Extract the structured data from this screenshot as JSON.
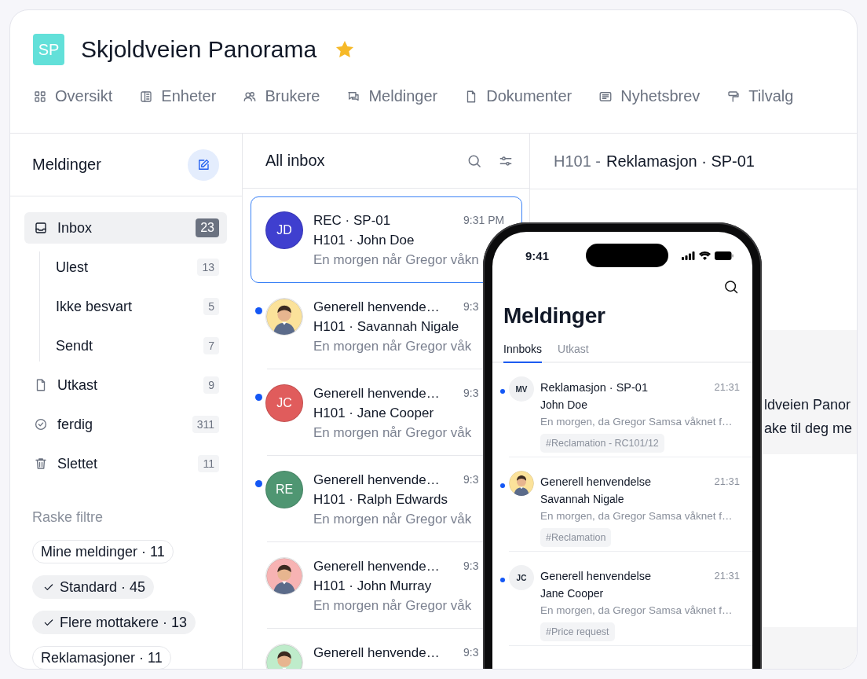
{
  "project": {
    "logo": "SP",
    "title": "Skjoldveien Panorama",
    "starred": true
  },
  "nav_tabs": [
    {
      "label": "Oversikt"
    },
    {
      "label": "Enheter"
    },
    {
      "label": "Brukere"
    },
    {
      "label": "Meldinger"
    },
    {
      "label": "Dokumenter"
    },
    {
      "label": "Nyhetsbrev"
    },
    {
      "label": "Tilvalg"
    }
  ],
  "sidebar": {
    "title": "Meldinger",
    "folders": [
      {
        "label": "Inbox",
        "count": "23",
        "selected": true,
        "children": [
          {
            "label": "Ulest",
            "count": "13",
            "selected": false
          },
          {
            "label": "Ikke besvart",
            "count": "5",
            "selected": false
          },
          {
            "label": "Sendt",
            "count": "7",
            "selected": false
          }
        ]
      },
      {
        "label": "Utkast",
        "count": "9",
        "selected": false
      },
      {
        "label": "ferdig",
        "count": "311",
        "selected": false
      },
      {
        "label": "Slettet",
        "count": "11",
        "selected": false
      }
    ],
    "filters_title": "Raske filtre",
    "filters": [
      {
        "label": "Mine meldinger · 11",
        "checked": false
      },
      {
        "label": "Standard · 45",
        "checked": true
      },
      {
        "label": "Flere mottakere · 13",
        "checked": true
      },
      {
        "label": "Reklamasjoner · 11",
        "checked": false
      }
    ]
  },
  "inbox": {
    "title": "All inbox",
    "messages": [
      {
        "avatar": {
          "kind": "initials",
          "text": "JD",
          "color": "#3f3fcf"
        },
        "title": "REC · SP-01",
        "subtitle": "H101 · John Doe",
        "preview": "En morgen når Gregor våkn",
        "time": "9:31 PM",
        "unread": false,
        "selected": true
      },
      {
        "title": "Generell henvende…",
        "subtitle": "H101 · Savannah Nigale",
        "preview": "En morgen når Gregor våk",
        "time": "9:3",
        "unread": true,
        "selected": false
      },
      {
        "avatar": {
          "kind": "initials",
          "text": "JC",
          "color": "#e05c5c"
        },
        "title": "Generell henvende…",
        "subtitle": "H101 · Jane Cooper",
        "preview": "En morgen når Gregor våk",
        "time": "9:3",
        "unread": true,
        "selected": false
      },
      {
        "avatar": {
          "kind": "initials",
          "text": "RE",
          "color": "#4f9672"
        },
        "title": "Generell henvende…",
        "subtitle": "H101 · Ralph Edwards",
        "preview": "En morgen når Gregor våk",
        "time": "9:3",
        "unread": true,
        "selected": false
      },
      {
        "title": "Generell henvende…",
        "subtitle": "H101 · John Murray",
        "preview": "En morgen når Gregor våk",
        "time": "9:3",
        "unread": false,
        "selected": false
      },
      {
        "title": "Generell henvende…",
        "time": "9:3",
        "unread": false,
        "selected": false
      }
    ]
  },
  "detail": {
    "prefix": "H101 -",
    "title": "Reklamasjon · SP-01",
    "message_lines": [
      "ldveien Panor",
      "ake til deg me"
    ]
  },
  "phone": {
    "time": "9:41",
    "title": "Meldinger",
    "tabs": [
      {
        "label": "Innboks",
        "selected": true
      },
      {
        "label": "Utkast",
        "selected": false
      }
    ],
    "messages": [
      {
        "avatar": {
          "kind": "initials",
          "text": "MV",
          "color": "#f0f1f3"
        },
        "title": "Reklamasjon · SP-01",
        "name": "John Doe",
        "preview": "En morgen, da Gregor Samsa våknet f…",
        "tag": "#Reclamation - RC101/12",
        "time": "21:31",
        "unread": true
      },
      {
        "title": "Generell henvendelse",
        "name": "Savannah Nigale",
        "preview": "En morgen, da Gregor Samsa våknet f…",
        "tag": "#Reclamation",
        "time": "21:31",
        "unread": true
      },
      {
        "avatar": {
          "kind": "initials",
          "text": "JC",
          "color": "#f0f1f3"
        },
        "title": "Generell henvendelse",
        "name": "Jane Cooper",
        "preview": "En morgen, da Gregor Samsa våknet f…",
        "tag": "#Price request",
        "time": "21:31",
        "unread": true
      }
    ]
  }
}
